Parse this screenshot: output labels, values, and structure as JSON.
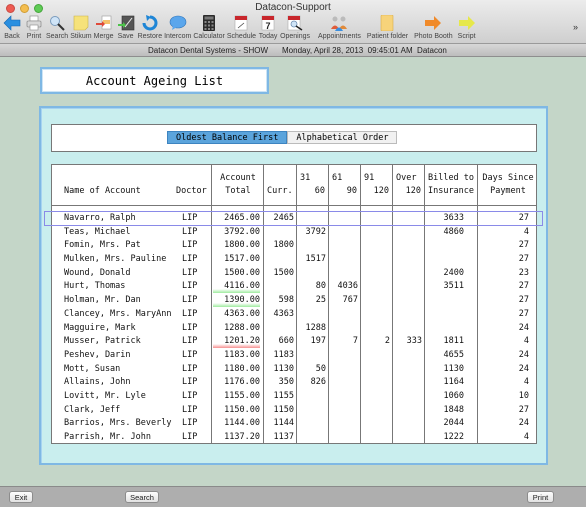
{
  "window": {
    "title": "Datacon-Support"
  },
  "toolbar": {
    "items": [
      {
        "label": "Back",
        "icon": "back-arrow-icon"
      },
      {
        "label": "Print",
        "icon": "printer-icon"
      },
      {
        "label": "Search",
        "icon": "magnifier-icon"
      },
      {
        "label": "Stikum",
        "icon": "sticky-note-icon"
      },
      {
        "label": "Merge",
        "icon": "merge-icon"
      },
      {
        "label": "Save",
        "icon": "save-icon"
      },
      {
        "label": "Restore",
        "icon": "restore-icon"
      },
      {
        "label": "Intercom",
        "icon": "speech-bubble-icon"
      },
      {
        "label": "Calculator",
        "icon": "calculator-icon"
      },
      {
        "label": "Schedule",
        "icon": "calendar-icon"
      },
      {
        "label": "Today",
        "icon": "calendar-today-icon",
        "day": "7"
      },
      {
        "label": "Openings",
        "icon": "calendar-search-icon"
      },
      {
        "label": "Appointments",
        "icon": "people-icon"
      },
      {
        "label": "Patient folder",
        "icon": "folder-icon"
      },
      {
        "label": "Photo Booth",
        "icon": "orange-arrow-icon"
      },
      {
        "label": "Script",
        "icon": "yellow-arrow-icon"
      }
    ],
    "overflow": "»"
  },
  "status": {
    "system": "Datacon Dental Systems - SHOW",
    "datetime": "Monday, April 28, 2013  09:45:01 AM  Datacon"
  },
  "report": {
    "title": "Account Ageing List"
  },
  "sort": {
    "options": [
      "Oldest Balance First",
      "Alphabetical Order"
    ],
    "selected": "Oldest Balance First"
  },
  "table": {
    "headers": {
      "name": "Name of Account",
      "doctor": "Doctor",
      "total_1": "Account",
      "total_2": "Total",
      "curr": "Curr.",
      "d31_1": "31",
      "d31_2": "60",
      "d61_1": "61",
      "d61_2": "90",
      "d91_1": "91",
      "d91_2": "120",
      "over_1": "Over",
      "over_2": "120",
      "ins_1": "Billed to",
      "ins_2": "Insurance",
      "days_1": "Days Since",
      "days_2": "Payment"
    },
    "rows": [
      {
        "name": "Navarro, Ralph",
        "doctor": "LIP",
        "total": "2465.00",
        "curr": "2465",
        "d31": "",
        "d61": "",
        "d91": "",
        "over": "",
        "ins": "3633",
        "days": "27",
        "selected": true,
        "highlight": ""
      },
      {
        "name": "Teas, Michael",
        "doctor": "LIP",
        "total": "3792.00",
        "curr": "",
        "d31": "3792",
        "d61": "",
        "d91": "",
        "over": "",
        "ins": "4860",
        "days": "4",
        "highlight": ""
      },
      {
        "name": "Fomin, Mrs. Pat",
        "doctor": "LIP",
        "total": "1800.00",
        "curr": "1800",
        "d31": "",
        "d61": "",
        "d91": "",
        "over": "",
        "ins": "",
        "days": "27",
        "highlight": ""
      },
      {
        "name": "Mulken, Mrs. Pauline",
        "doctor": "LIP",
        "total": "1517.00",
        "curr": "",
        "d31": "1517",
        "d61": "",
        "d91": "",
        "over": "",
        "ins": "",
        "days": "27",
        "highlight": ""
      },
      {
        "name": "Wound, Donald",
        "doctor": "LIP",
        "total": "1500.00",
        "curr": "1500",
        "d31": "",
        "d61": "",
        "d91": "",
        "over": "",
        "ins": "2400",
        "days": "23",
        "highlight": ""
      },
      {
        "name": "Hurt, Thomas",
        "doctor": "LIP",
        "total": "4116.00",
        "curr": "",
        "d31": "80",
        "d61": "4036",
        "d91": "",
        "over": "",
        "ins": "3511",
        "days": "27",
        "highlight": "green"
      },
      {
        "name": "Holman, Mr. Dan",
        "doctor": "LIP",
        "total": "1390.00",
        "curr": "598",
        "d31": "25",
        "d61": "767",
        "d91": "",
        "over": "",
        "ins": "",
        "days": "27",
        "highlight": "green"
      },
      {
        "name": "Clancey, Mrs. MaryAnn",
        "doctor": "LIP",
        "total": "4363.00",
        "curr": "4363",
        "d31": "",
        "d61": "",
        "d91": "",
        "over": "",
        "ins": "",
        "days": "27",
        "highlight": ""
      },
      {
        "name": "Magguire, Mark",
        "doctor": "LIP",
        "total": "1288.00",
        "curr": "",
        "d31": "1288",
        "d61": "",
        "d91": "",
        "over": "",
        "ins": "",
        "days": "24",
        "highlight": ""
      },
      {
        "name": "Musser, Patrick",
        "doctor": "LIP",
        "total": "1201.20",
        "curr": "660",
        "d31": "197",
        "d61": "7",
        "d91": "2",
        "over": "333",
        "ins": "1811",
        "days": "4",
        "highlight": "red"
      },
      {
        "name": "Peshev, Darin",
        "doctor": "LIP",
        "total": "1183.00",
        "curr": "1183",
        "d31": "",
        "d61": "",
        "d91": "",
        "over": "",
        "ins": "4655",
        "days": "24",
        "highlight": ""
      },
      {
        "name": "Mott, Susan",
        "doctor": "LIP",
        "total": "1180.00",
        "curr": "1130",
        "d31": "50",
        "d61": "",
        "d91": "",
        "over": "",
        "ins": "1130",
        "days": "24",
        "highlight": ""
      },
      {
        "name": "Allains, John",
        "doctor": "LIP",
        "total": "1176.00",
        "curr": "350",
        "d31": "826",
        "d61": "",
        "d91": "",
        "over": "",
        "ins": "1164",
        "days": "4",
        "highlight": ""
      },
      {
        "name": "Lovitt, Mr. Lyle",
        "doctor": "LIP",
        "total": "1155.00",
        "curr": "1155",
        "d31": "",
        "d61": "",
        "d91": "",
        "over": "",
        "ins": "1060",
        "days": "10",
        "highlight": ""
      },
      {
        "name": "Clark, Jeff",
        "doctor": "LIP",
        "total": "1150.00",
        "curr": "1150",
        "d31": "",
        "d61": "",
        "d91": "",
        "over": "",
        "ins": "1848",
        "days": "27",
        "highlight": ""
      },
      {
        "name": "Barrios, Mrs. Beverly",
        "doctor": "LIP",
        "total": "1144.00",
        "curr": "1144",
        "d31": "",
        "d61": "",
        "d91": "",
        "over": "",
        "ins": "2044",
        "days": "24",
        "highlight": ""
      },
      {
        "name": "Parrish, Mr. John",
        "doctor": "LIP",
        "total": "1137.20",
        "curr": "1137",
        "d31": "",
        "d61": "",
        "d91": "",
        "over": "",
        "ins": "1222",
        "days": "4",
        "highlight": ""
      }
    ]
  },
  "bottom": {
    "exit": "Exit",
    "search": "Search",
    "print": "Print"
  }
}
